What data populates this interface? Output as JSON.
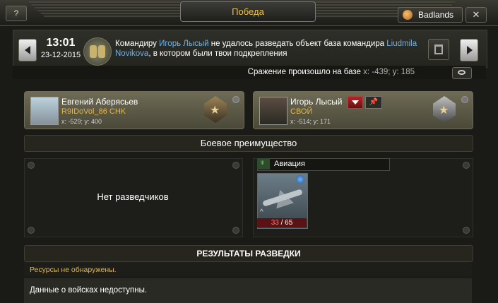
{
  "window": {
    "help_label": "?",
    "title": "Победа",
    "server": "Badlands",
    "close_label": "✕"
  },
  "message": {
    "time": "13:01",
    "date": "23-12-2015",
    "text_prefix": "Командиру ",
    "commander": "Игорь Лысый",
    "text_mid": " не удалось разведать объект база командира ",
    "target": "Liudmila Novikova",
    "text_suffix": ", в котором были твои подкрепления"
  },
  "battle": {
    "label": "Сражение произошло на базе",
    "coords": "x: -439; y: 185"
  },
  "attacker": {
    "name": "Евгений Аберясьев",
    "clan": "R9IDoVol_86 CHK",
    "coords": "x: -529; y: 400"
  },
  "defender": {
    "name": "Игорь Лысый",
    "clan": "СВОЙ",
    "coords": "x: -514; y: 171"
  },
  "advantage": {
    "title": "Боевое преимущество",
    "no_scouts": "Нет разведчиков"
  },
  "aviation": {
    "title": "Авиация",
    "unit": {
      "name": "drone",
      "current": "33",
      "separator": " / ",
      "total": "65"
    }
  },
  "results": {
    "title": "РЕЗУЛЬТАТЫ РАЗВЕДКИ",
    "resources": "Ресурсы не обнаружены.",
    "troops": "Данные о войсках недоступны."
  },
  "colors": {
    "accent": "#f0c246",
    "link": "#72b0e0",
    "clan": "#e3b74b"
  }
}
